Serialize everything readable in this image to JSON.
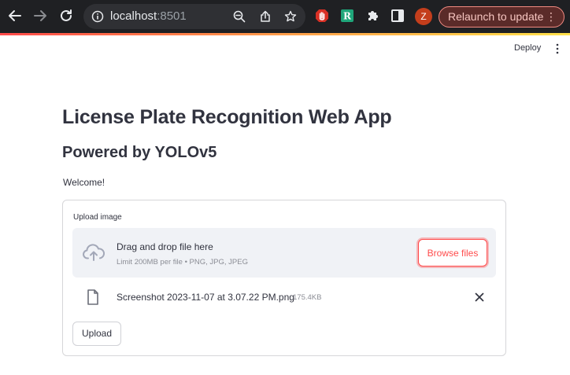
{
  "browser": {
    "url_host": "localhost",
    "url_port": ":8501",
    "avatar_letter": "Z",
    "relaunch_label": "Relaunch to update",
    "relaunch_menu": "⋮",
    "icons": [
      "back-arrow-icon",
      "forward-arrow-icon",
      "reload-icon",
      "info-icon",
      "zoom-out-icon",
      "share-icon",
      "star-icon",
      "stop-hand-extension-icon",
      "r-extension-icon",
      "puzzle-extensions-icon",
      "side-panel-icon"
    ],
    "accent_gradient": [
      "#ff4b4b",
      "#ff9f4b",
      "#ffe14b"
    ]
  },
  "header": {
    "deploy_label": "Deploy",
    "menu_icon": "kebab-menu-icon"
  },
  "main": {
    "title": "License Plate Recognition Web App",
    "subtitle": "Powered by YOLOv5",
    "welcome": "Welcome!"
  },
  "uploader": {
    "label": "Upload image",
    "drop_title": "Drag and drop file here",
    "drop_limit": "Limit 200MB per file • PNG, JPG, JPEG",
    "browse_label": "Browse files",
    "file": {
      "name": "Screenshot 2023-11-07 at 3.07.22 PM.png",
      "size": "175.4KB"
    },
    "upload_label": "Upload",
    "accent_color": "#ff4b4b"
  }
}
